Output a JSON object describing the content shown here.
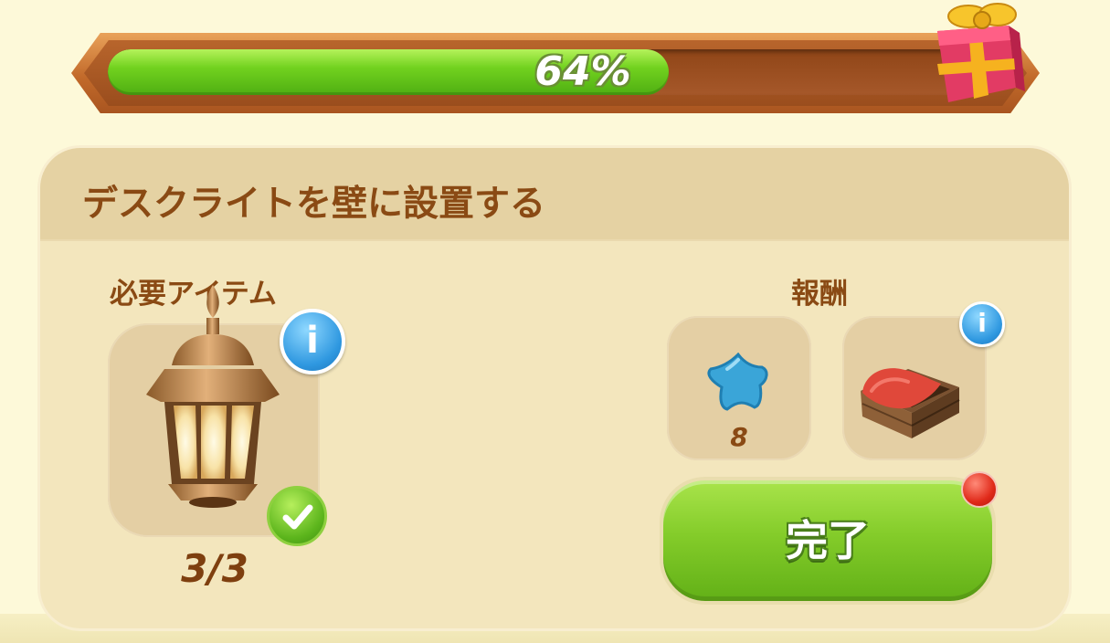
{
  "progress": {
    "percent": 64,
    "label": "64%"
  },
  "task": {
    "title": "デスクライトを壁に設置する"
  },
  "required": {
    "label": "必要アイテム",
    "item_icon": "lantern-icon",
    "count": "3/3",
    "completed": true
  },
  "reward": {
    "label": "報酬",
    "items": [
      {
        "icon": "blue-star-icon",
        "amount": "8"
      },
      {
        "icon": "fabric-crate-icon"
      }
    ]
  },
  "complete_button": {
    "label": "完了",
    "has_notification": true
  },
  "colors": {
    "background": "#fdf9d9",
    "panel": "#f3e6bd",
    "header": "#e5d2a3",
    "text_brown": "#8a4a14",
    "progress_green": "#72d21f",
    "button_green": "#84cc2a"
  }
}
